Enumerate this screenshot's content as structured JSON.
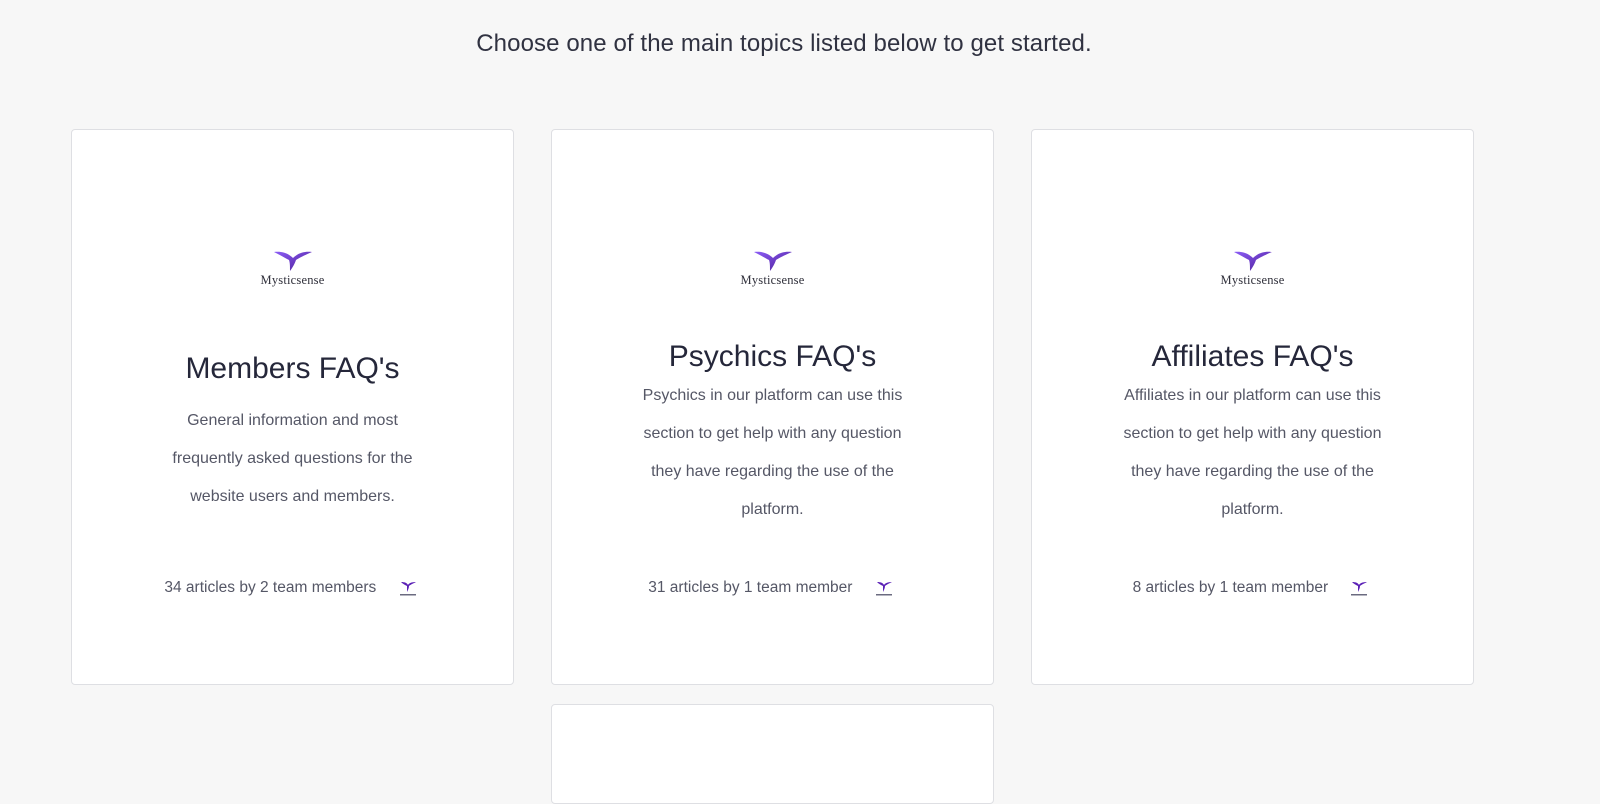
{
  "intro": "Choose one of the main topics listed below to get started.",
  "brand": {
    "name": "Mysticsense",
    "accent": "#6b2fd6",
    "accent_light": "#8b5cf6"
  },
  "collections": [
    {
      "title": "Members FAQ's",
      "description": "General information and most frequently asked questions for the website users and members.",
      "meta": "34 articles by 2 team members",
      "avatar_icon": "mysticsense-avatar-icon"
    },
    {
      "title": "Psychics FAQ's",
      "description": "Psychics in our platform can use this section to get help with any question they have regarding the use of the platform.",
      "meta": "31 articles by 1 team member",
      "avatar_icon": "mysticsense-avatar-icon"
    },
    {
      "title": "Affiliates FAQ's",
      "description": "Affiliates in our platform can use this section to get help with any question they have regarding the use of the platform.",
      "meta": "8 articles by 1 team member",
      "avatar_icon": "mysticsense-avatar-icon"
    }
  ]
}
